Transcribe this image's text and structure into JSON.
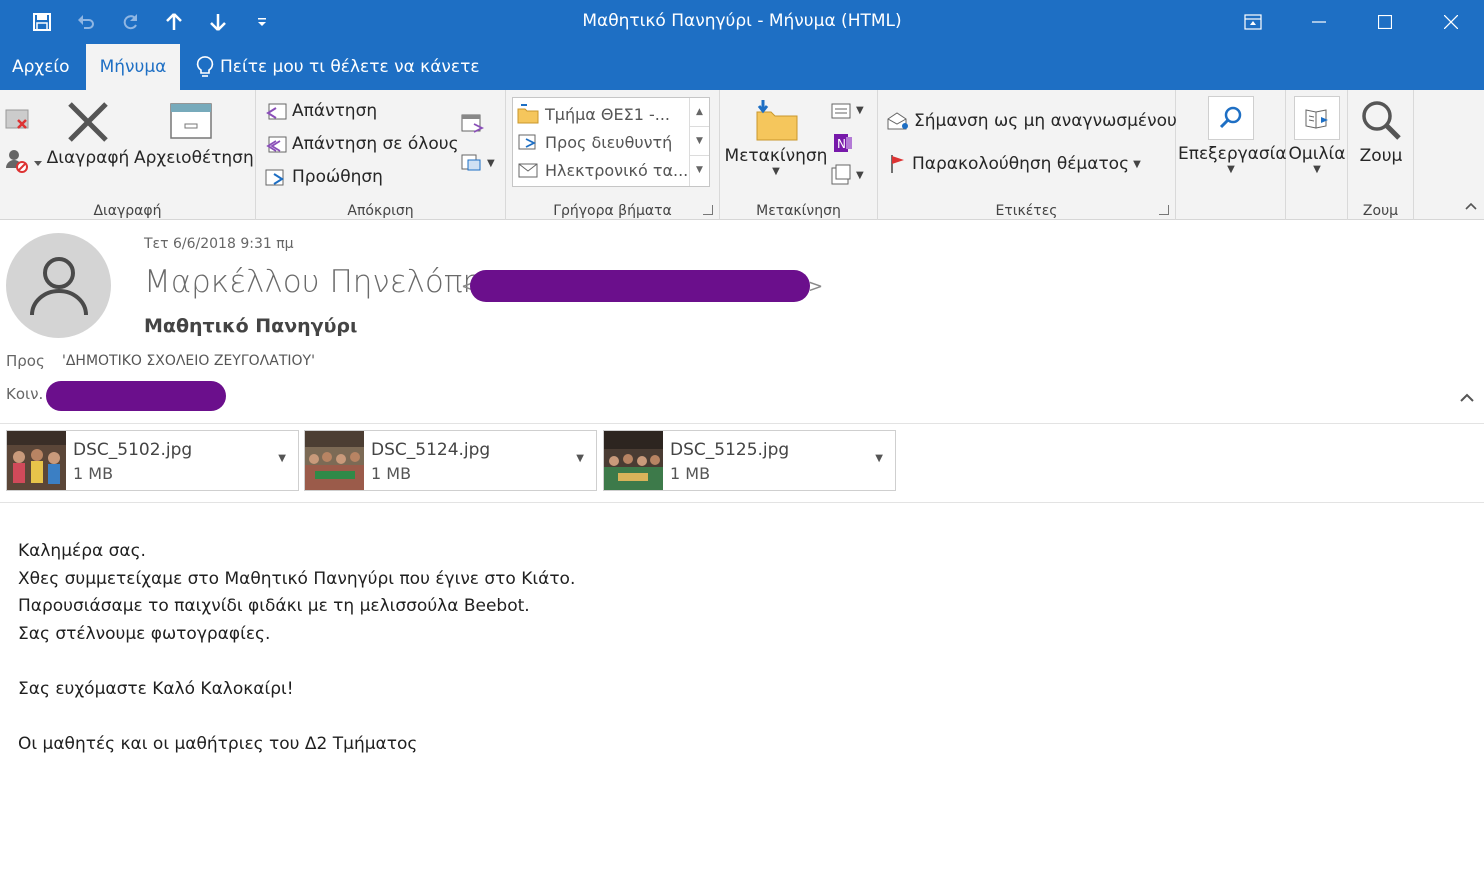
{
  "window": {
    "title": "Μαθητικό Πανηγύρι  -  Μήνυμα (HTML)"
  },
  "tabs": {
    "file": "Αρχείο",
    "message": "Μήνυμα",
    "tell_me": "Πείτε μου τι θέλετε να κάνετε"
  },
  "ribbon": {
    "delete_group": {
      "label": "Διαγραφή",
      "delete": "Διαγραφή",
      "archive": "Αρχειοθέτηση"
    },
    "respond_group": {
      "label": "Απόκριση",
      "reply": "Απάντηση",
      "reply_all": "Απάντηση σε όλους",
      "forward": "Προώθηση"
    },
    "quick_steps_group": {
      "label": "Γρήγορα βήματα",
      "items": [
        "Τμήμα ΘΕΣ1 -...",
        "Προς διευθυντή",
        "Ηλεκτρονικό τα..."
      ]
    },
    "move_group": {
      "label": "Μετακίνηση",
      "move": "Μετακίνηση"
    },
    "tags_group": {
      "label": "Ετικέτες",
      "mark_unread": "Σήμανση ως μη αναγνωσμένου",
      "follow_up": "Παρακολούθηση θέματος"
    },
    "editing": {
      "label": "Επεξεργασία"
    },
    "speech": {
      "label": "Ομιλία"
    },
    "zoom_group": {
      "label": "Ζουμ",
      "zoom": "Ζουμ"
    }
  },
  "message": {
    "date": "Τετ 6/6/2018 9:31 πμ",
    "sender_name": "Μαρκέλλου Πηνελόπη",
    "subject": "Μαθητικό Πανηγύρι",
    "to_label": "Προς",
    "to_value": "'ΔΗΜΟΤΙΚΟ ΣΧΟΛΕΙΟ ΖΕΥΓΟΛΑΤΙΟΥ'",
    "cc_label": "Κοιν."
  },
  "attachments": [
    {
      "name": "DSC_5102.jpg",
      "size": "1 MB"
    },
    {
      "name": "DSC_5124.jpg",
      "size": "1 MB"
    },
    {
      "name": "DSC_5125.jpg",
      "size": "1 MB"
    }
  ],
  "body": {
    "lines": [
      "Καλημέρα σας.",
      "Χθες συμμετείχαμε στο Μαθητικό Πανηγύρι που έγινε στο Κιάτο.",
      "Παρουσιάσαμε το παιχνίδι φιδάκι με τη μελισσούλα Beebot.",
      "Σας στέλνουμε φωτογραφίες.",
      "",
      "Σας ευχόμαστε Καλό Καλοκαίρι!",
      "",
      "Οι μαθητές και οι μαθήτριες του Δ2 Τμήματος"
    ]
  },
  "colors": {
    "accent": "#1e6fc4",
    "redaction": "#6b0f8c"
  }
}
